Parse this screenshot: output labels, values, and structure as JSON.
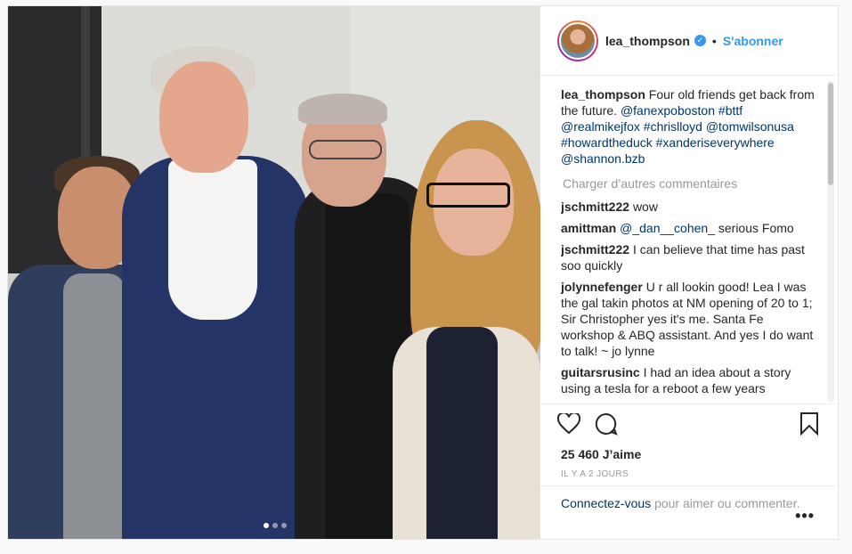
{
  "post": {
    "username": "lea_thompson",
    "follow_label": "S'abonner",
    "separator": "•",
    "verified_mark": "✓"
  },
  "caption": {
    "username": "lea_thompson",
    "text": "Four old friends get back from the future.",
    "tags": [
      "@fanexpoboston",
      "#bttf",
      "@realmikejfox",
      "#chrislloyd",
      "@tomwilsonusa",
      "#howardtheduck",
      "#xanderiseverywhere",
      "@shannon.bzb"
    ]
  },
  "load_more_label": "Charger d’autres commentaires",
  "comments": [
    {
      "user": "jschmitt222",
      "text": "wow"
    },
    {
      "user": "amittman",
      "mention": "@_dan__cohen_",
      "text": "serious Fomo"
    },
    {
      "user": "jschmitt222",
      "text": "I can believe that time has past soo quickly"
    },
    {
      "user": "jolynnefenger",
      "text": "U r all lookin good! Lea I was the gal takin photos at NM opening of 20 to 1; Sir Christopher yes it's me. Santa Fe workshop & ABQ assistant. And yes I do want to talk! ~ jo lynne"
    },
    {
      "user": "guitarsrusinc",
      "text": "I had an idea about a story using a tesla for a reboot a few years"
    }
  ],
  "icons": {
    "like": "heart-icon",
    "comment": "comment-bubble-icon",
    "save": "bookmark-icon",
    "more": "more-options-icon",
    "verified": "verified-badge-icon"
  },
  "likes_label": "25 460 J’aime",
  "timestamp": "IL Y A 2 JOURS",
  "footer": {
    "login_link": "Connectez-vous",
    "login_suffix": "pour aimer ou commenter.",
    "more_label": "•••"
  },
  "carousel": {
    "count": 3,
    "active_index": 0
  },
  "colors": {
    "accent": "#3897f0",
    "link": "#003569",
    "muted": "#999999",
    "text": "#262626"
  }
}
